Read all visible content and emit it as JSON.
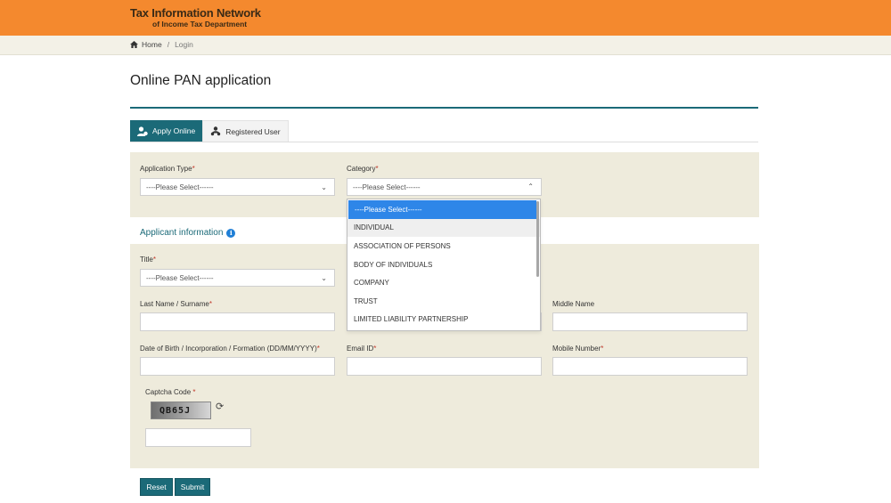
{
  "header": {
    "logo_line1": "Tax Information Network",
    "logo_line2": "of Income Tax Department",
    "color": "#f4892e"
  },
  "breadcrumb": {
    "home": "Home",
    "separator": "/",
    "current": "Login"
  },
  "page": {
    "title": "Online PAN application"
  },
  "tabs": [
    {
      "label": "Apply Online",
      "icon": "user-icon",
      "active": true
    },
    {
      "label": "Registered User",
      "icon": "users-icon",
      "active": false
    }
  ],
  "form": {
    "application_type": {
      "label": "Application Type",
      "required": "*",
      "value": "----Please Select------"
    },
    "category": {
      "label": "Category",
      "required": "*",
      "value": "----Please Select------",
      "options": [
        "----Please Select------",
        "INDIVIDUAL",
        "ASSOCIATION OF PERSONS",
        "BODY OF INDIVIDUALS",
        "COMPANY",
        "TRUST",
        "LIMITED LIABILITY PARTNERSHIP"
      ]
    },
    "applicant_section": "Applicant information",
    "title_field": {
      "label": "Title",
      "required": "*",
      "value": "----Please Select------"
    },
    "last_name": {
      "label": "Last Name / Surname",
      "required": "*"
    },
    "middle_name": {
      "label": "Middle Name"
    },
    "dob": {
      "label": "Date of Birth / Incorporation / Formation (DD/MM/YYYY)",
      "required": "*"
    },
    "email": {
      "label": "Email ID",
      "required": "*"
    },
    "mobile": {
      "label": "Mobile Number",
      "required": "*"
    },
    "captcha": {
      "label": "Captcha Code",
      "required": "*",
      "code": "QB65J"
    }
  },
  "buttons": {
    "reset": "Reset",
    "submit": "Submit"
  },
  "colors": {
    "teal": "#1b6a78",
    "panel": "#eeebdc",
    "highlight": "#2e86e8"
  }
}
